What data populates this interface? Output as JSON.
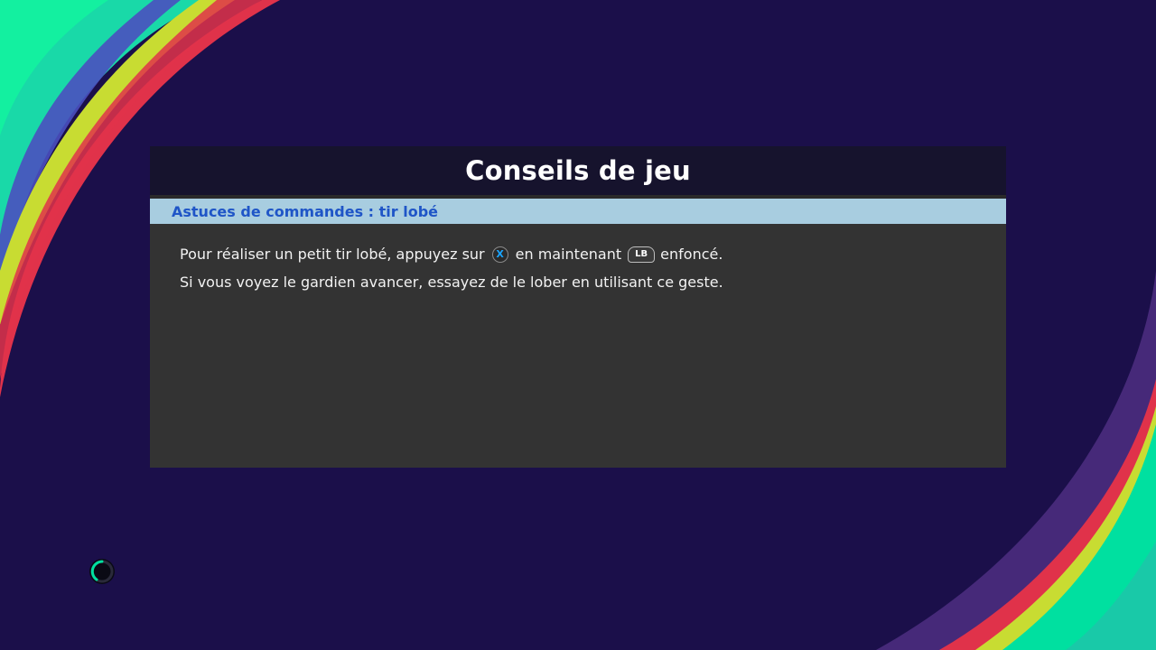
{
  "header": {
    "title": "Conseils de jeu"
  },
  "tip": {
    "category": "Astuces de commandes : tir lobé",
    "line1_part1": "Pour réaliser un petit tir lobé, appuyez sur",
    "button_x": "X",
    "line1_part2": "en maintenant",
    "button_lb": "LB",
    "line1_part3": "enfoncé.",
    "line2": "Si vous voyez le gardien avancer, essayez de le lober en utilisant ce geste."
  },
  "colors": {
    "background": "#1b0f4a",
    "accent_green": "#00e0a0",
    "accent_red": "#e0324a",
    "accent_yellow": "#c8dc32",
    "panel": "#333333",
    "header": "#16132d",
    "subheader": "#a8cde0",
    "subheader_text": "#1f55c7",
    "x_button": "#1aa5ff"
  },
  "loading": {
    "icon": "loading-spinner-icon"
  }
}
